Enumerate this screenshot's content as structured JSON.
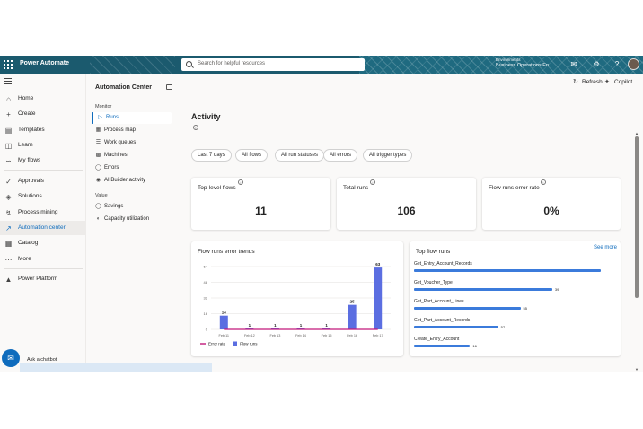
{
  "topbar": {
    "app_name": "Power Automate",
    "search_placeholder": "Search for helpful resources",
    "environment_label": "Environments",
    "environment_name": "Business Operations En..."
  },
  "leftnav": {
    "items": [
      {
        "label": "Home",
        "icon": "home-icon"
      },
      {
        "label": "Create",
        "icon": "plus-icon"
      },
      {
        "label": "Templates",
        "icon": "templates-icon"
      },
      {
        "label": "Learn",
        "icon": "book-icon"
      },
      {
        "label": "My flows",
        "icon": "flow-icon"
      },
      {
        "label": "Approvals",
        "icon": "approvals-icon"
      },
      {
        "label": "Solutions",
        "icon": "solutions-icon"
      },
      {
        "label": "Process mining",
        "icon": "process-mining-icon"
      },
      {
        "label": "Automation center",
        "icon": "automation-center-icon",
        "active": true
      },
      {
        "label": "Catalog",
        "icon": "catalog-icon"
      },
      {
        "label": "More",
        "icon": "more-icon"
      },
      {
        "label": "Power Platform",
        "icon": "power-platform-icon"
      }
    ]
  },
  "automation_center": {
    "title": "Automation Center",
    "monitor_label": "Monitor",
    "monitor_items": [
      {
        "label": "Runs",
        "active": true
      },
      {
        "label": "Process map"
      },
      {
        "label": "Work queues"
      },
      {
        "label": "Machines"
      },
      {
        "label": "Errors"
      },
      {
        "label": "AI Builder activity"
      }
    ],
    "value_label": "Value",
    "value_items": [
      {
        "label": "Savings"
      },
      {
        "label": "Capacity utilization"
      }
    ]
  },
  "chatbot": {
    "label": "Ask a chatbot"
  },
  "commands": {
    "refresh": "Refresh",
    "copilot": "Copilot"
  },
  "page": {
    "title": "Activity"
  },
  "filters": [
    "Last 7 days",
    "All flows",
    "All run statuses",
    "All errors",
    "All trigger types"
  ],
  "kpis": [
    {
      "label": "Top-level flows",
      "value": "11"
    },
    {
      "label": "Total runs",
      "value": "106"
    },
    {
      "label": "Flow runs error rate",
      "value": "0%"
    }
  ],
  "trend_card": {
    "title": "Flow runs error trends"
  },
  "top_flows": {
    "title": "Top flow runs",
    "see_more": "See more",
    "items": [
      {
        "name": "Get_Entry_Account_Records",
        "value": ""
      },
      {
        "name": "Get_Voucher_Type",
        "value": "39"
      },
      {
        "name": "Get_Part_Account_Lines",
        "value": "55"
      },
      {
        "name": "Get_Part_Account_Records",
        "value": "57"
      },
      {
        "name": "Create_Entry_Account",
        "value": "16"
      }
    ],
    "fractions": [
      1.0,
      0.74,
      0.57,
      0.45,
      0.3
    ]
  },
  "chart_data": {
    "type": "bar",
    "title": "Flow runs error trends",
    "categories": [
      "Feb 11",
      "Feb 12",
      "Feb 13",
      "Feb 14",
      "Feb 15",
      "Feb 16",
      "Feb 17"
    ],
    "series": [
      {
        "name": "Flow runs",
        "type": "bar",
        "color": "#5b6ee1",
        "values": [
          14,
          1,
          1,
          1,
          1,
          25,
          63
        ]
      },
      {
        "name": "Error rate",
        "type": "line",
        "color": "#c2187a",
        "values": [
          0,
          0,
          0,
          0,
          0,
          0,
          0
        ]
      }
    ],
    "yticks": [
      "64",
      "48",
      "32",
      "16",
      "0"
    ],
    "ylim": [
      0,
      64
    ],
    "grid": true,
    "legend": "bottom-left"
  }
}
